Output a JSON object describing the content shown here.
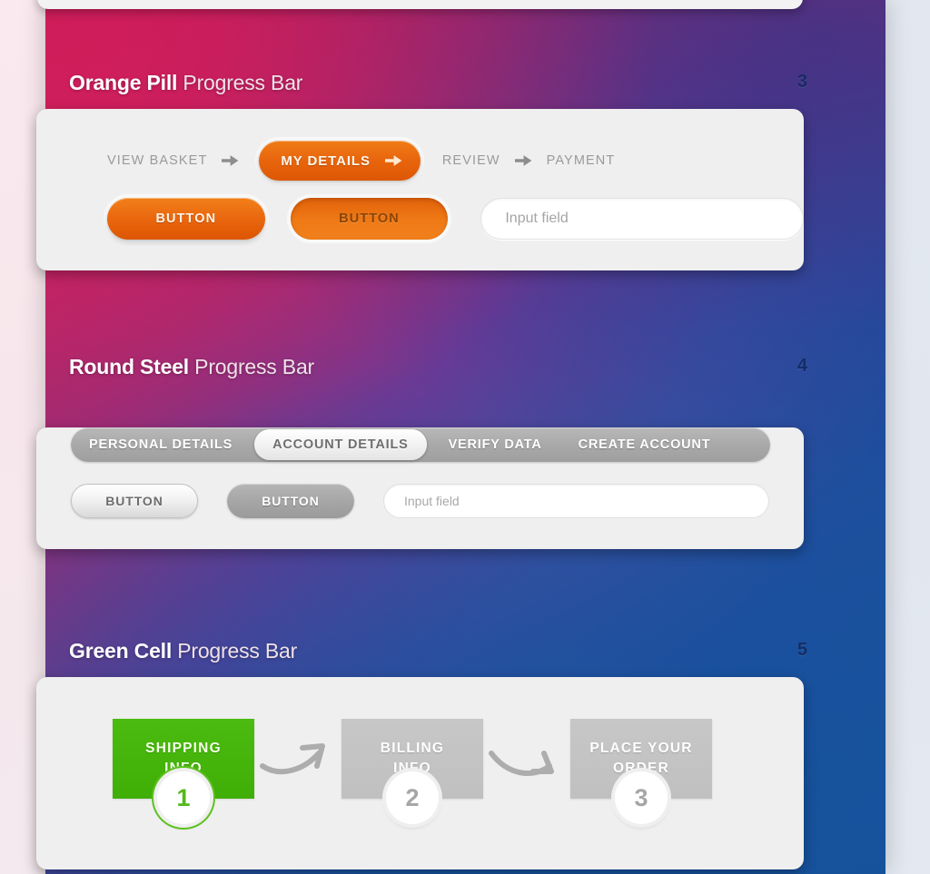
{
  "sections": [
    {
      "title_bold": "Orange Pill",
      "title_rest": " Progress Bar",
      "number": "3",
      "steps": [
        {
          "label": "VIEW BASKET",
          "active": false
        },
        {
          "label": "MY DETAILS",
          "active": true
        },
        {
          "label": "REVIEW",
          "active": false
        },
        {
          "label": "PAYMENT",
          "active": false
        }
      ],
      "buttons": [
        {
          "label": "BUTTON",
          "state": "normal"
        },
        {
          "label": "BUTTON",
          "state": "pressed"
        }
      ],
      "input": {
        "value": "",
        "placeholder": "Input field"
      },
      "arrow_icon": "arrow-right-icon"
    },
    {
      "title_bold": "Round Steel",
      "title_rest": " Progress Bar",
      "number": "4",
      "steps": [
        {
          "label": "PERSONAL DETAILS",
          "active": false
        },
        {
          "label": "ACCOUNT DETAILS",
          "active": true
        },
        {
          "label": "VERIFY DATA",
          "active": false
        },
        {
          "label": "CREATE ACCOUNT",
          "active": false
        }
      ],
      "buttons": [
        {
          "label": "BUTTON",
          "state": "light"
        },
        {
          "label": "BUTTON",
          "state": "dark"
        }
      ],
      "input": {
        "value": "",
        "placeholder": "Input field"
      }
    },
    {
      "title_bold": "Green Cell",
      "title_rest": " Progress Bar",
      "number": "5",
      "cells": [
        {
          "line1": "SHIPPING",
          "line2": "INFO",
          "badge": "1",
          "done": true
        },
        {
          "line1": "BILLING",
          "line2": "INFO",
          "badge": "2",
          "done": false
        },
        {
          "line1": "PLACE YOUR",
          "line2": "ORDER",
          "badge": "3",
          "done": false
        }
      ],
      "connector_icon": "curved-arrow-icon"
    }
  ],
  "colors": {
    "orange": "#e8650d",
    "green": "#4cbb10",
    "steel": "#a9a9a9",
    "panel": "#efefef",
    "section_number": "#12295e"
  }
}
